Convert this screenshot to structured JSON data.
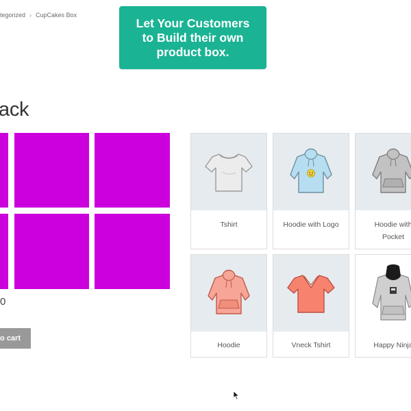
{
  "breadcrumb": {
    "parent": "tegorized",
    "separator": "›",
    "current": "CupCakes Box"
  },
  "banner": {
    "text": "Let Your Customers\nto Build their own\nproduct box.",
    "color": "#1ab394"
  },
  "product": {
    "title": "ack",
    "price": "0",
    "add_to_cart_label": "to cart",
    "slot_color": "#cc00dd",
    "slots_filled": 0,
    "slot_count": 6
  },
  "products": [
    {
      "name": "Tshirt",
      "icon": "tshirt-icon",
      "color": "#e9e9e9"
    },
    {
      "name": "Hoodie with Logo",
      "icon": "hoodie-with-logo-icon",
      "color": "#a9d8ea"
    },
    {
      "name": "Hoodie with\nPocket",
      "icon": "hoodie-with-pocket-icon",
      "color": "#b9b9b9"
    },
    {
      "name": "Hoodie",
      "icon": "hoodie-icon",
      "color": "#f2988a"
    },
    {
      "name": "Vneck Tshirt",
      "icon": "vneck-tshirt-icon",
      "color": "#f57f6b"
    },
    {
      "name": "Happy Ninja",
      "icon": "happy-ninja-hoodie-icon",
      "color": "#c4c4c4"
    }
  ]
}
